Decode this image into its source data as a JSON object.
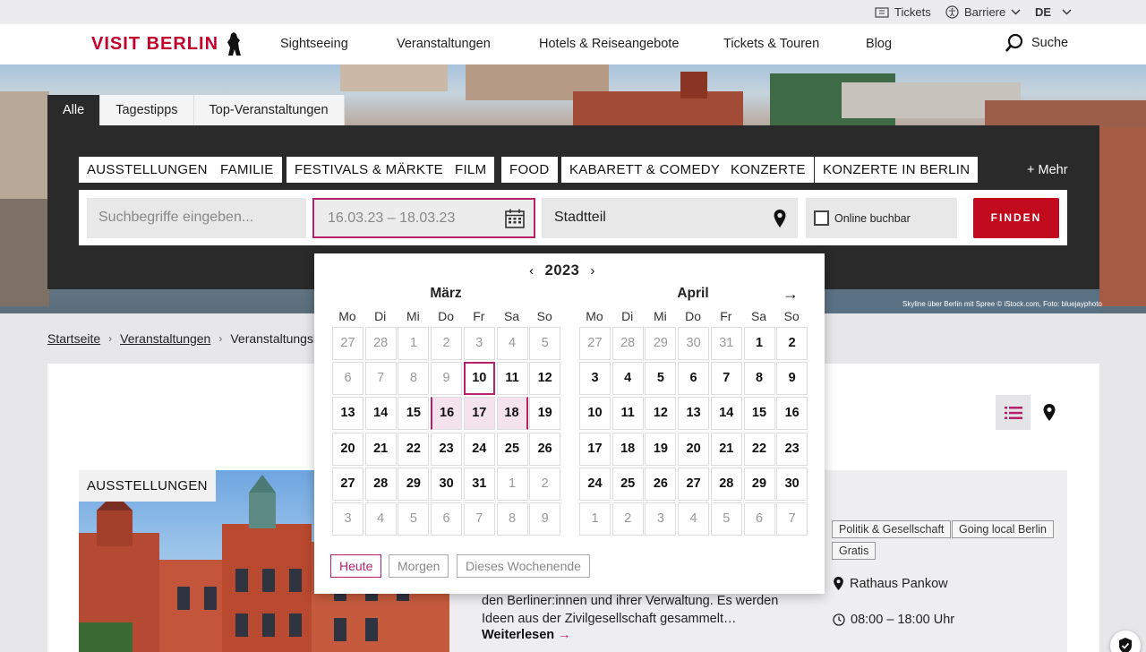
{
  "utility": {
    "tickets": "Tickets",
    "barriere": "Barriere",
    "language": "DE"
  },
  "nav": {
    "logo_visit": "VISIT",
    "logo_berlin": "BERLIN",
    "items": [
      "Sightseeing",
      "Veranstaltungen",
      "Hotels & Reiseangebote",
      "Tickets & Touren",
      "Blog"
    ],
    "search": "Suche"
  },
  "hero": {
    "credit": "Skyline über Berlin mit Spree © iStock.com, Foto: bluejayphoto"
  },
  "tabs": [
    "Alle",
    "Tagestipps",
    "Top-Veranstaltungen"
  ],
  "categories": [
    "AUSSTELLUNGEN",
    "FAMILIE",
    "FESTIVALS & MÄRKTE",
    "FILM",
    "FOOD",
    "KABARETT & COMEDY",
    "KONZERTE",
    "KONZERTE IN BERLIN"
  ],
  "more": "+ Mehr",
  "search": {
    "keyword_placeholder": "Suchbegriffe eingeben...",
    "date_range": "16.03.23 – 18.03.23",
    "district": "Stadtteil",
    "online": "Online buchbar",
    "find": "FINDEN"
  },
  "breadcrumb": {
    "home": "Startseite",
    "events": "Veranstaltungen",
    "current": "Veranstaltungska"
  },
  "calendar": {
    "year": "2023",
    "weekdays": [
      "Mo",
      "Di",
      "Mi",
      "Do",
      "Fr",
      "Sa",
      "So"
    ],
    "months": [
      {
        "name": "März",
        "weeks": [
          [
            {
              "d": "27",
              "s": "other"
            },
            {
              "d": "28",
              "s": "other"
            },
            {
              "d": "1",
              "s": "past"
            },
            {
              "d": "2",
              "s": "past"
            },
            {
              "d": "3",
              "s": "past"
            },
            {
              "d": "4",
              "s": "past"
            },
            {
              "d": "5",
              "s": "past"
            }
          ],
          [
            {
              "d": "6",
              "s": "past"
            },
            {
              "d": "7",
              "s": "past"
            },
            {
              "d": "8",
              "s": "past"
            },
            {
              "d": "9",
              "s": "past"
            },
            {
              "d": "10",
              "s": "today"
            },
            {
              "d": "11",
              "s": ""
            },
            {
              "d": "12",
              "s": ""
            }
          ],
          [
            {
              "d": "13",
              "s": ""
            },
            {
              "d": "14",
              "s": ""
            },
            {
              "d": "15",
              "s": ""
            },
            {
              "d": "16",
              "s": "range rstart"
            },
            {
              "d": "17",
              "s": "range"
            },
            {
              "d": "18",
              "s": "range rend"
            },
            {
              "d": "19",
              "s": ""
            }
          ],
          [
            {
              "d": "20",
              "s": ""
            },
            {
              "d": "21",
              "s": ""
            },
            {
              "d": "22",
              "s": ""
            },
            {
              "d": "23",
              "s": ""
            },
            {
              "d": "24",
              "s": ""
            },
            {
              "d": "25",
              "s": ""
            },
            {
              "d": "26",
              "s": ""
            }
          ],
          [
            {
              "d": "27",
              "s": ""
            },
            {
              "d": "28",
              "s": ""
            },
            {
              "d": "29",
              "s": ""
            },
            {
              "d": "30",
              "s": ""
            },
            {
              "d": "31",
              "s": ""
            },
            {
              "d": "1",
              "s": "other"
            },
            {
              "d": "2",
              "s": "other"
            }
          ],
          [
            {
              "d": "3",
              "s": "other"
            },
            {
              "d": "4",
              "s": "other"
            },
            {
              "d": "5",
              "s": "other"
            },
            {
              "d": "6",
              "s": "other"
            },
            {
              "d": "7",
              "s": "other"
            },
            {
              "d": "8",
              "s": "other"
            },
            {
              "d": "9",
              "s": "other"
            }
          ]
        ]
      },
      {
        "name": "April",
        "weeks": [
          [
            {
              "d": "27",
              "s": "other"
            },
            {
              "d": "28",
              "s": "other"
            },
            {
              "d": "29",
              "s": "other"
            },
            {
              "d": "30",
              "s": "other"
            },
            {
              "d": "31",
              "s": "other"
            },
            {
              "d": "1",
              "s": ""
            },
            {
              "d": "2",
              "s": ""
            }
          ],
          [
            {
              "d": "3",
              "s": ""
            },
            {
              "d": "4",
              "s": ""
            },
            {
              "d": "5",
              "s": ""
            },
            {
              "d": "6",
              "s": ""
            },
            {
              "d": "7",
              "s": ""
            },
            {
              "d": "8",
              "s": ""
            },
            {
              "d": "9",
              "s": ""
            }
          ],
          [
            {
              "d": "10",
              "s": ""
            },
            {
              "d": "11",
              "s": ""
            },
            {
              "d": "12",
              "s": ""
            },
            {
              "d": "13",
              "s": ""
            },
            {
              "d": "14",
              "s": ""
            },
            {
              "d": "15",
              "s": ""
            },
            {
              "d": "16",
              "s": ""
            }
          ],
          [
            {
              "d": "17",
              "s": ""
            },
            {
              "d": "18",
              "s": ""
            },
            {
              "d": "19",
              "s": ""
            },
            {
              "d": "20",
              "s": ""
            },
            {
              "d": "21",
              "s": ""
            },
            {
              "d": "22",
              "s": ""
            },
            {
              "d": "23",
              "s": ""
            }
          ],
          [
            {
              "d": "24",
              "s": ""
            },
            {
              "d": "25",
              "s": ""
            },
            {
              "d": "26",
              "s": ""
            },
            {
              "d": "27",
              "s": ""
            },
            {
              "d": "28",
              "s": ""
            },
            {
              "d": "29",
              "s": ""
            },
            {
              "d": "30",
              "s": ""
            }
          ],
          [
            {
              "d": "1",
              "s": "other"
            },
            {
              "d": "2",
              "s": "other"
            },
            {
              "d": "3",
              "s": "other"
            },
            {
              "d": "4",
              "s": "other"
            },
            {
              "d": "5",
              "s": "other"
            },
            {
              "d": "6",
              "s": "other"
            },
            {
              "d": "7",
              "s": "other"
            }
          ]
        ]
      }
    ],
    "quick": [
      "Heute",
      "Morgen",
      "Dieses Wochenende"
    ]
  },
  "result": {
    "category": "AUSSTELLUNGEN",
    "tags": [
      "Politik & Gesellschaft",
      "Going local Berlin",
      "Gratis"
    ],
    "location": "Rathaus Pankow",
    "time": "08:00 – 18:00 Uhr",
    "teaser": "den Berliner:innen und ihrer Verwaltung. Es werden Ideen aus der Zivilgesellschaft gesammelt…",
    "read_more": "Weiterlesen"
  },
  "colors": {
    "accent": "#b5216b",
    "brand_red": "#c2002b",
    "button_red": "#c20a1f",
    "panel_dark": "#2a2a2a"
  }
}
